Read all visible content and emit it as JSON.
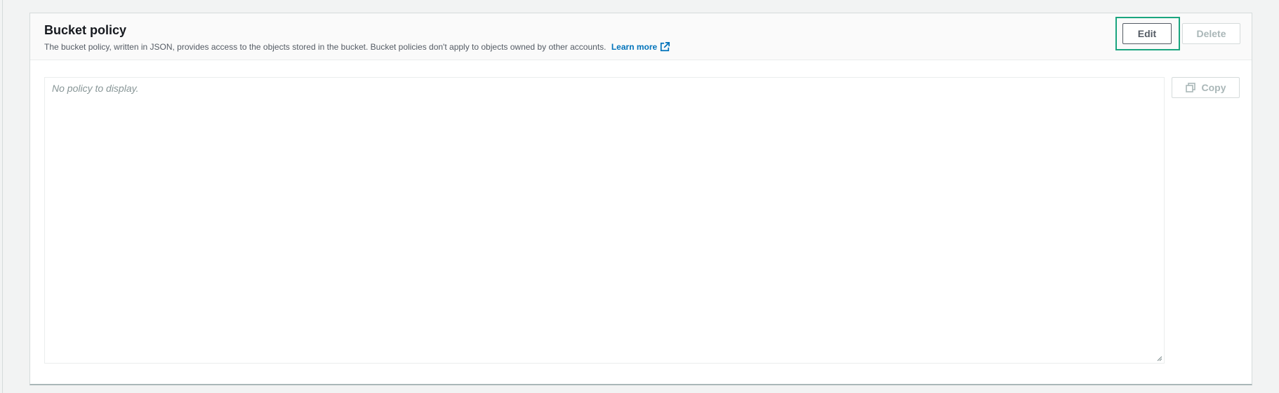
{
  "bucket_policy": {
    "title": "Bucket policy",
    "description": "The bucket policy, written in JSON, provides access to the objects stored in the bucket. Bucket policies don't apply to objects owned by other accounts.",
    "learn_more": "Learn more",
    "external_link_icon": "external-link-icon",
    "buttons": {
      "edit": "Edit",
      "delete": "Delete",
      "copy": "Copy"
    },
    "copy_icon": "copy-icon",
    "policy_placeholder": "No policy to display.",
    "colors": {
      "link": "#0073bb",
      "highlight": "#1aa57f",
      "disabled": "#aab7b8"
    }
  }
}
